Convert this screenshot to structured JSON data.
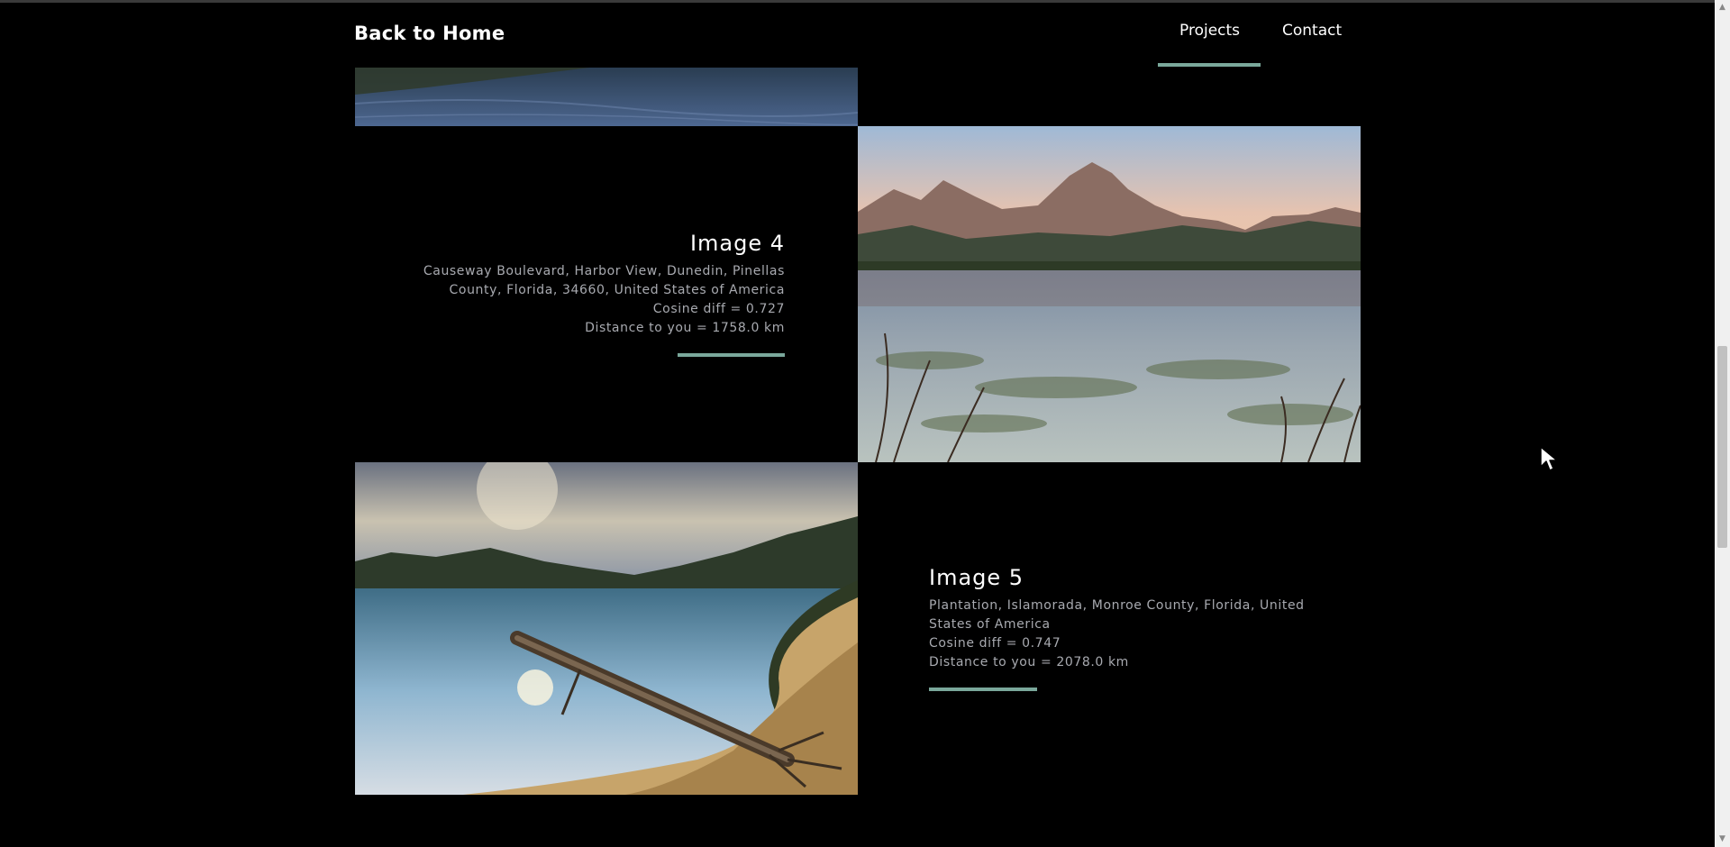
{
  "header": {
    "brand": "Back to Home",
    "nav": [
      {
        "label": "Projects",
        "active": true
      },
      {
        "label": "Contact",
        "active": false
      }
    ],
    "accent_color": "#7aa89b"
  },
  "gallery": [
    {
      "title": "Image 4",
      "address": "Causeway Boulevard, Harbor View, Dunedin, Pinellas County, Florida, 34660, United States of America",
      "cosine": "Cosine diff = 0.727",
      "distance": "Distance to you = 1758.0 km"
    },
    {
      "title": "Image 5",
      "address": "Plantation, Islamorada, Monroe County, Florida, United States of America",
      "cosine": "Cosine diff = 0.747",
      "distance": "Distance to you = 2078.0 km"
    }
  ],
  "icons": {
    "scroll_up": "scroll-up-arrow-icon",
    "scroll_down": "scroll-down-arrow-icon",
    "cursor": "mouse-pointer-icon"
  }
}
